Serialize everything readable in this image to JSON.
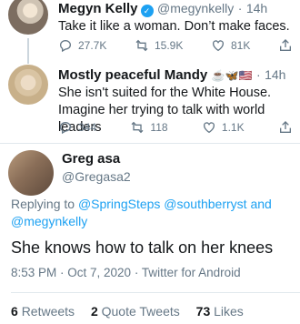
{
  "tweet1": {
    "name": "Megyn Kelly",
    "handle": "@megynkelly",
    "time": "14h",
    "text": "Take it like a woman. Don’t make faces.",
    "replies": "27.7K",
    "retweets": "15.9K",
    "likes": "81K"
  },
  "tweet2": {
    "name": "Mostly peaceful Mandy",
    "emoji": "☕🦋🇺🇸",
    "time": "14h",
    "text": "She isn't suited for the White House. Imagine her trying to talk with world leaders",
    "replies": "344",
    "retweets": "118",
    "likes": "1.1K"
  },
  "tweet3": {
    "name": "Greg asa",
    "handle": "@Gregasa2",
    "replying_label": "Replying to",
    "replying_to": "@SpringSteps @southberryst and @megynkelly",
    "text": "She knows how to talk on her knees",
    "timestamp": "8:53 PM · Oct 7, 2020 · Twitter for Android"
  },
  "stats": {
    "retweets_count": "6",
    "retweets_label": "Retweets",
    "quotes_count": "2",
    "quotes_label": "Quote Tweets",
    "likes_count": "73",
    "likes_label": "Likes"
  },
  "colors": {
    "accent": "#1da1f2",
    "muted": "#657786",
    "text": "#14171a",
    "divider": "#e1e8ed"
  },
  "icons": [
    "reply-icon",
    "retweet-icon",
    "like-icon",
    "share-icon",
    "verified-badge-icon"
  ]
}
